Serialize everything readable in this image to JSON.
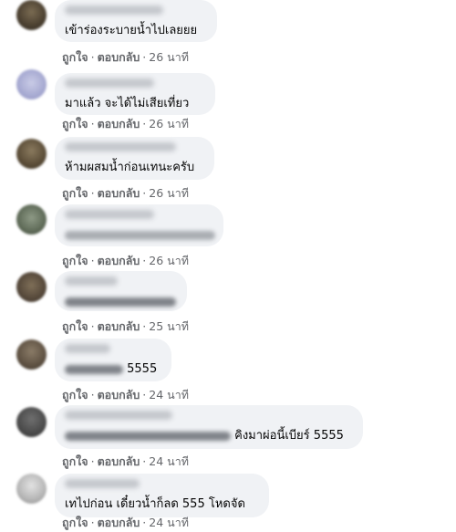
{
  "comments": [
    {
      "text": "เข้าร่องระบายน้ำไปเลยยย",
      "like": "ถูกใจ",
      "reply": "ตอบกลับ",
      "time": "26 นาที"
    },
    {
      "text": "มาแล้ว จะได้ไม่เสียเที่ยว",
      "like": "ถูกใจ",
      "reply": "ตอบกลับ",
      "time": "26 นาที"
    },
    {
      "text": "ห้ามผสมน้ำก่อนเทนะครับ",
      "like": "ถูกใจ",
      "reply": "ตอบกลับ",
      "time": "26 นาที"
    },
    {
      "text": "",
      "like": "ถูกใจ",
      "reply": "ตอบกลับ",
      "time": "26 นาที"
    },
    {
      "text": "",
      "like": "ถูกใจ",
      "reply": "ตอบกลับ",
      "time": "25 นาที"
    },
    {
      "text": "5555",
      "like": "ถูกใจ",
      "reply": "ตอบกลับ",
      "time": "24 นาที"
    },
    {
      "text": "คิงมาผ่อนี้เบียร์ 5555",
      "like": "ถูกใจ",
      "reply": "ตอบกลับ",
      "time": "24 นาที"
    },
    {
      "text": "เทไปก่อน เดี๋ยวน้ำก็ลด 555 โหดจัด",
      "like": "ถูกใจ",
      "reply": "ตอบกลับ",
      "time": "24 นาที"
    }
  ],
  "colors": {
    "bubble": "#f0f2f5",
    "meta_text": "#65676b",
    "comment_text": "#050505"
  }
}
